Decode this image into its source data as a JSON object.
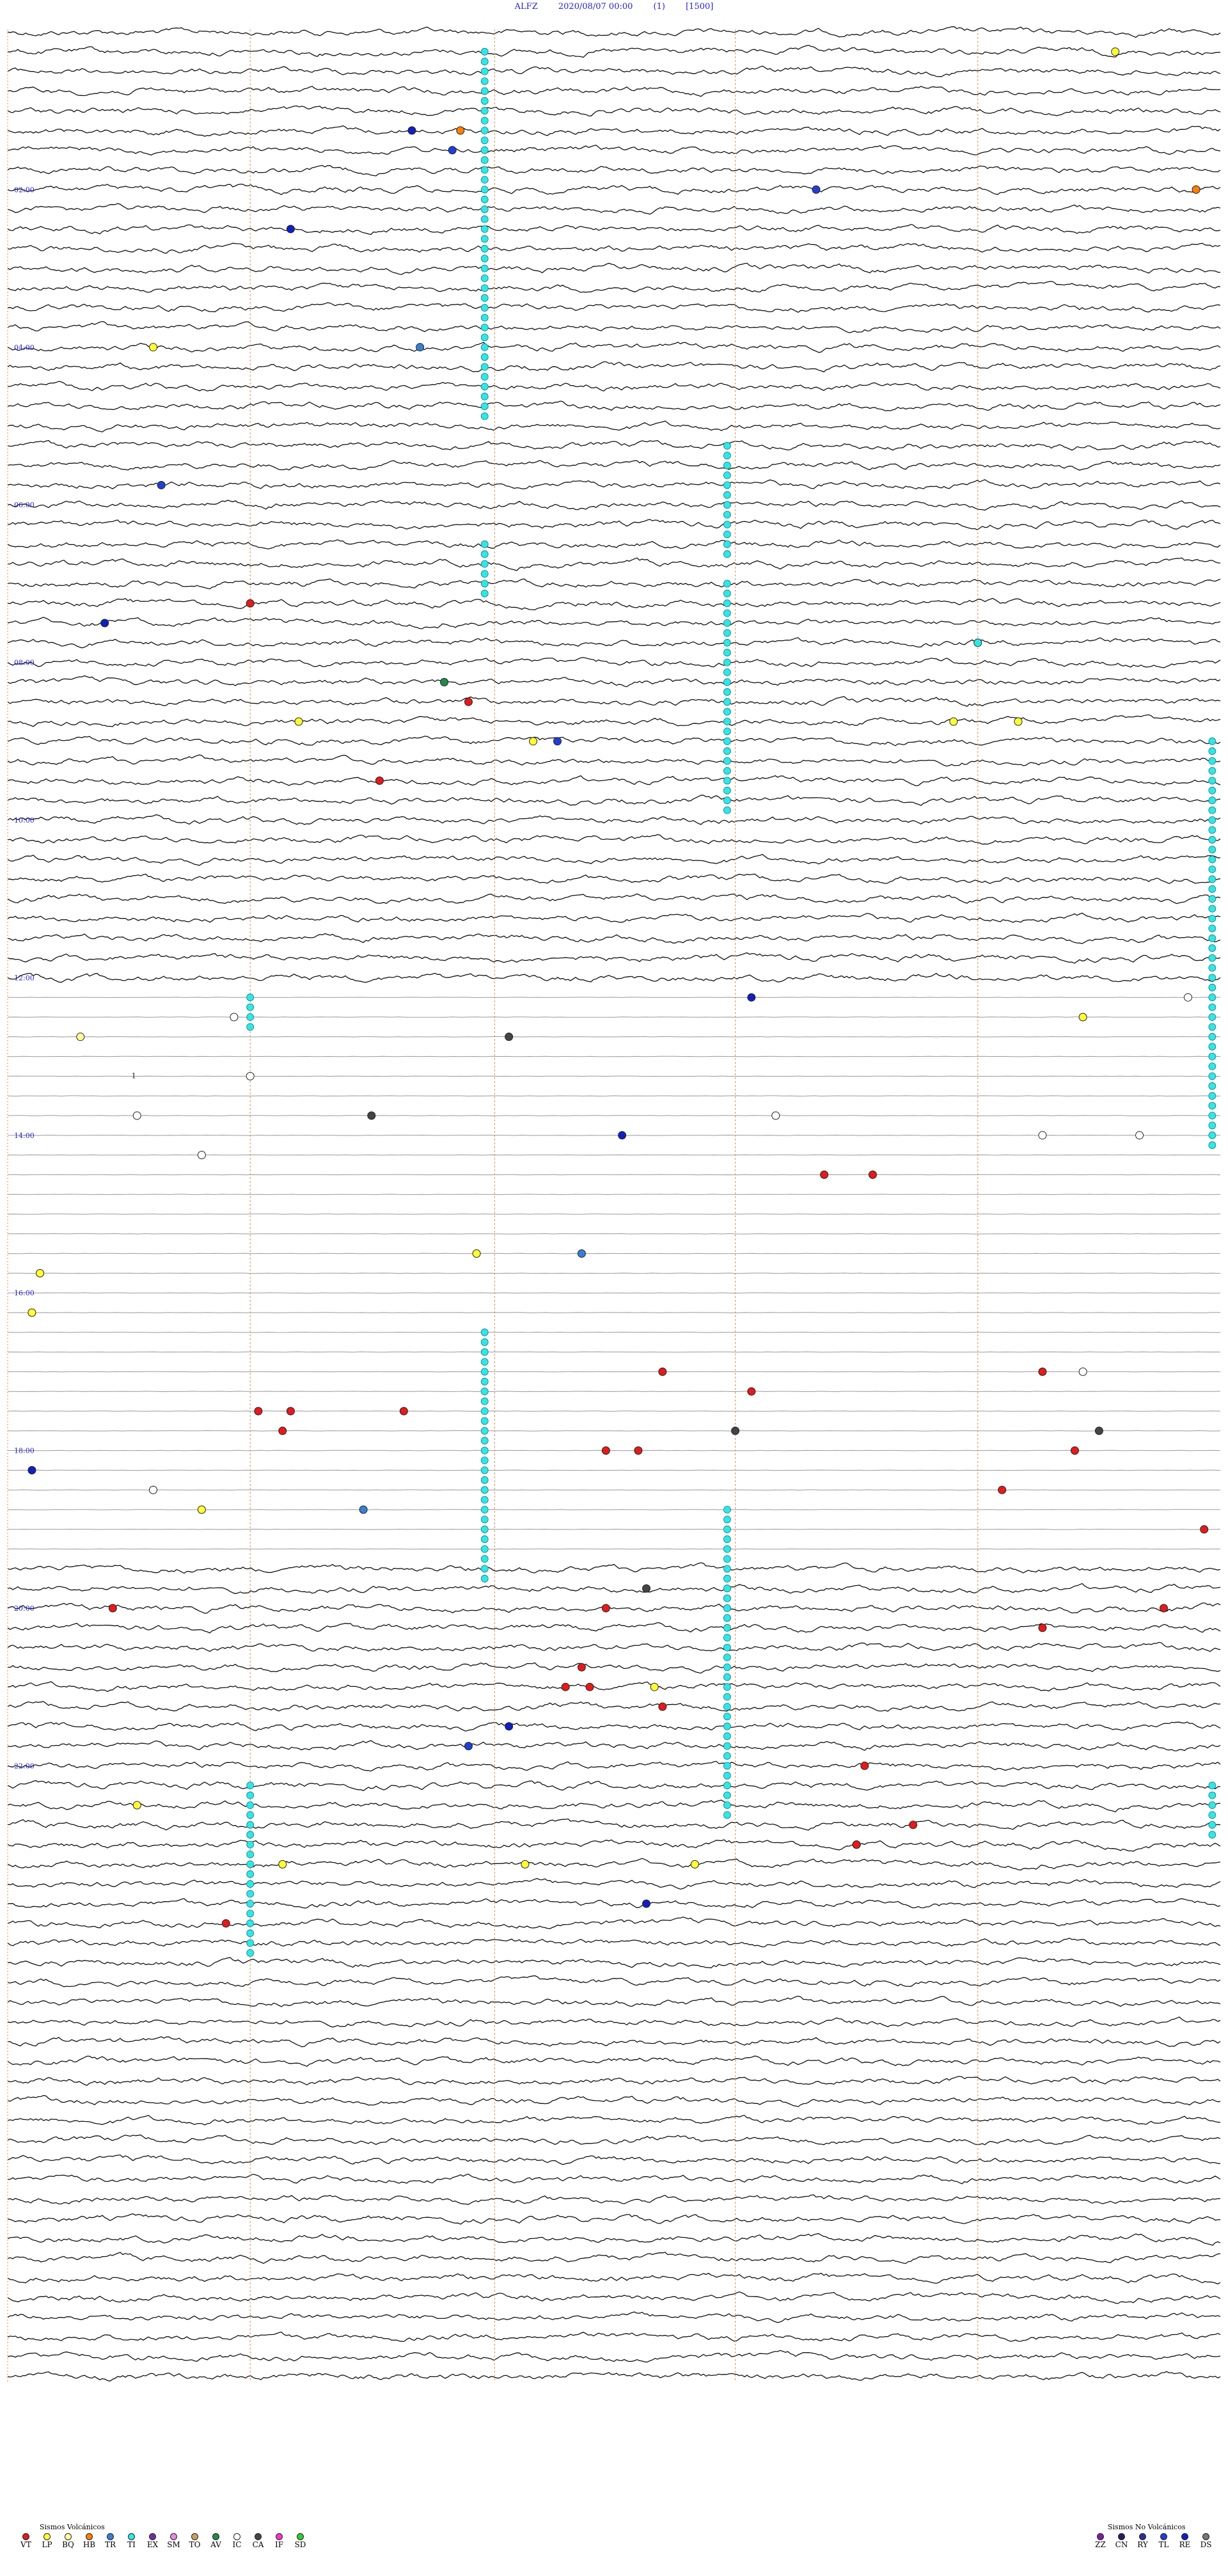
{
  "header": {
    "station": "ALFZ",
    "datetime": "2020/08/07 00:00",
    "channel": "(1)",
    "scale": "[1500]"
  },
  "chart_data": {
    "type": "helicorder",
    "rows": 120,
    "row_minutes": 15,
    "time_labels": [
      {
        "row": 8,
        "text": "02:00"
      },
      {
        "row": 16,
        "text": "04:00"
      },
      {
        "row": 24,
        "text": "06:00"
      },
      {
        "row": 32,
        "text": "08:00"
      },
      {
        "row": 40,
        "text": "10:00"
      },
      {
        "row": 48,
        "text": "12:00"
      },
      {
        "row": 56,
        "text": "14:00"
      },
      {
        "row": 64,
        "text": "16:00"
      },
      {
        "row": 72,
        "text": "18:00"
      },
      {
        "row": 80,
        "text": "20:00"
      },
      {
        "row": 88,
        "text": "22:00"
      }
    ],
    "flat_rows": [
      49,
      78
    ],
    "annotation": {
      "row": 53,
      "minute": 1.5,
      "text": "1"
    },
    "events": [
      {
        "row": 1,
        "minute": 13.7,
        "type": "LP"
      },
      {
        "row": 5,
        "minute": 5.0,
        "type": "RE"
      },
      {
        "row": 5,
        "minute": 5.6,
        "type": "HB"
      },
      {
        "row": 6,
        "minute": 5.5,
        "type": "TL"
      },
      {
        "row": 8,
        "minute": 10.0,
        "type": "TL"
      },
      {
        "row": 8,
        "minute": 14.7,
        "type": "HB"
      },
      {
        "row": 10,
        "minute": 3.5,
        "type": "RE"
      },
      {
        "row": 16,
        "minute": 1.8,
        "type": "LP"
      },
      {
        "row": 16,
        "minute": 5.1,
        "type": "TR"
      },
      {
        "row": 23,
        "minute": 1.9,
        "type": "TL"
      },
      {
        "row": 29,
        "minute": 3.0,
        "type": "VT"
      },
      {
        "row": 30,
        "minute": 1.2,
        "type": "RE"
      },
      {
        "row": 31,
        "minute": 12.0,
        "type": "TI"
      },
      {
        "row": 33,
        "minute": 5.4,
        "type": "AV"
      },
      {
        "row": 34,
        "minute": 5.7,
        "type": "VT"
      },
      {
        "row": 35,
        "minute": 11.7,
        "type": "LP"
      },
      {
        "row": 35,
        "minute": 12.5,
        "type": "LP"
      },
      {
        "row": 35,
        "minute": 3.6,
        "type": "LP"
      },
      {
        "row": 36,
        "minute": 6.5,
        "type": "LP"
      },
      {
        "row": 36,
        "minute": 6.8,
        "type": "TL"
      },
      {
        "row": 38,
        "minute": 4.6,
        "type": "VT"
      },
      {
        "row": 49,
        "minute": 9.2,
        "type": "RE"
      },
      {
        "row": 49,
        "minute": 14.6,
        "type": "IC"
      },
      {
        "row": 50,
        "minute": 2.8,
        "type": "IC"
      },
      {
        "row": 50,
        "minute": 13.3,
        "type": "LP"
      },
      {
        "row": 51,
        "minute": 0.9,
        "type": "BQ"
      },
      {
        "row": 51,
        "minute": 6.2,
        "type": "CA"
      },
      {
        "row": 53,
        "minute": 3.0,
        "type": "IC"
      },
      {
        "row": 55,
        "minute": 1.6,
        "type": "IC"
      },
      {
        "row": 55,
        "minute": 4.5,
        "type": "CA"
      },
      {
        "row": 55,
        "minute": 9.5,
        "type": "IC"
      },
      {
        "row": 56,
        "minute": 7.6,
        "type": "RE"
      },
      {
        "row": 56,
        "minute": 12.8,
        "type": "IC"
      },
      {
        "row": 56,
        "minute": 14.0,
        "type": "IC"
      },
      {
        "row": 57,
        "minute": 2.4,
        "type": "IC"
      },
      {
        "row": 58,
        "minute": 10.1,
        "type": "VT"
      },
      {
        "row": 58,
        "minute": 10.7,
        "type": "VT"
      },
      {
        "row": 62,
        "minute": 5.8,
        "type": "LP"
      },
      {
        "row": 62,
        "minute": 7.1,
        "type": "TR"
      },
      {
        "row": 63,
        "minute": 0.4,
        "type": "LP"
      },
      {
        "row": 65,
        "minute": 0.3,
        "type": "LP"
      },
      {
        "row": 68,
        "minute": 8.1,
        "type": "VT"
      },
      {
        "row": 68,
        "minute": 12.8,
        "type": "VT"
      },
      {
        "row": 68,
        "minute": 13.3,
        "type": "IC"
      },
      {
        "row": 69,
        "minute": 9.2,
        "type": "VT"
      },
      {
        "row": 70,
        "minute": 3.1,
        "type": "VT"
      },
      {
        "row": 70,
        "minute": 3.5,
        "type": "VT"
      },
      {
        "row": 70,
        "minute": 4.9,
        "type": "VT"
      },
      {
        "row": 71,
        "minute": 9.0,
        "type": "CA"
      },
      {
        "row": 71,
        "minute": 13.5,
        "type": "CA"
      },
      {
        "row": 71,
        "minute": 3.4,
        "type": "VT"
      },
      {
        "row": 72,
        "minute": 7.4,
        "type": "VT"
      },
      {
        "row": 72,
        "minute": 7.8,
        "type": "VT"
      },
      {
        "row": 72,
        "minute": 13.2,
        "type": "VT"
      },
      {
        "row": 73,
        "minute": 0.3,
        "type": "RE"
      },
      {
        "row": 74,
        "minute": 1.8,
        "type": "VT"
      },
      {
        "row": 74,
        "minute": 1.8,
        "type": "IC"
      },
      {
        "row": 74,
        "minute": 12.3,
        "type": "VT"
      },
      {
        "row": 75,
        "minute": 2.4,
        "type": "LP"
      },
      {
        "row": 75,
        "minute": 4.4,
        "type": "TR"
      },
      {
        "row": 76,
        "minute": 14.8,
        "type": "VT"
      },
      {
        "row": 79,
        "minute": 7.9,
        "type": "CA"
      },
      {
        "row": 80,
        "minute": 1.3,
        "type": "VT"
      },
      {
        "row": 80,
        "minute": 7.4,
        "type": "VT"
      },
      {
        "row": 80,
        "minute": 14.3,
        "type": "VT"
      },
      {
        "row": 81,
        "minute": 12.8,
        "type": "VT"
      },
      {
        "row": 83,
        "minute": 7.1,
        "type": "VT"
      },
      {
        "row": 84,
        "minute": 6.9,
        "type": "VT"
      },
      {
        "row": 84,
        "minute": 7.2,
        "type": "VT"
      },
      {
        "row": 84,
        "minute": 8.0,
        "type": "LP"
      },
      {
        "row": 85,
        "minute": 8.1,
        "type": "VT"
      },
      {
        "row": 86,
        "minute": 6.2,
        "type": "RE"
      },
      {
        "row": 87,
        "minute": 5.7,
        "type": "TL"
      },
      {
        "row": 88,
        "minute": 10.6,
        "type": "VT"
      },
      {
        "row": 90,
        "minute": 1.6,
        "type": "LP"
      },
      {
        "row": 91,
        "minute": 11.2,
        "type": "VT"
      },
      {
        "row": 92,
        "minute": 10.5,
        "type": "VT"
      },
      {
        "row": 92,
        "minute": 10.5,
        "type": "VT"
      },
      {
        "row": 93,
        "minute": 6.4,
        "type": "LP"
      },
      {
        "row": 93,
        "minute": 8.5,
        "type": "LP"
      },
      {
        "row": 93,
        "minute": 3.4,
        "type": "LP"
      },
      {
        "row": 95,
        "minute": 7.9,
        "type": "RE"
      },
      {
        "row": 96,
        "minute": 2.7,
        "type": "VT"
      }
    ],
    "ti_runs": [
      {
        "start": 1,
        "end": 19,
        "minute": 5.9
      },
      {
        "start": 21,
        "end": 26,
        "minute": 8.9
      },
      {
        "start": 26,
        "end": 28,
        "minute": 5.9
      },
      {
        "start": 28,
        "end": 39,
        "minute": 8.9
      },
      {
        "start": 36,
        "end": 56,
        "minute": 14.9
      },
      {
        "start": 49,
        "end": 50,
        "minute": 3.0
      },
      {
        "start": 66,
        "end": 78,
        "minute": 5.9
      },
      {
        "start": 75,
        "end": 80,
        "minute": 8.9
      },
      {
        "start": 79,
        "end": 90,
        "minute": 8.9
      },
      {
        "start": 89,
        "end": 97,
        "minute": 3.0
      },
      {
        "start": 89,
        "end": 91,
        "minute": 14.9
      }
    ],
    "legend_volcanic": {
      "title": "Sismos Volcánicos",
      "items": [
        {
          "code": "VT",
          "color": "#e41a1c"
        },
        {
          "code": "LP",
          "color": "#ffff33"
        },
        {
          "code": "BQ",
          "color": "#ffff99"
        },
        {
          "code": "HB",
          "color": "#ff7f00"
        },
        {
          "code": "TR",
          "color": "#3a7fd5"
        },
        {
          "code": "TI",
          "color": "#2ee8e8"
        },
        {
          "code": "EX",
          "color": "#7030a0"
        },
        {
          "code": "SM",
          "color": "#e08ae0"
        },
        {
          "code": "TO",
          "color": "#c8a060"
        },
        {
          "code": "AV",
          "color": "#1f8a4c"
        },
        {
          "code": "IC",
          "color": "#ffffff"
        },
        {
          "code": "CA",
          "color": "#444444"
        },
        {
          "code": "IF",
          "color": "#ff33cc"
        },
        {
          "code": "SD",
          "color": "#33cc33"
        }
      ]
    },
    "legend_nonvolcanic": {
      "title": "Sismos No Volcánicos",
      "items": [
        {
          "code": "ZZ",
          "color": "#7a1fa2"
        },
        {
          "code": "CN",
          "color": "#202060"
        },
        {
          "code": "RY",
          "color": "#303090"
        },
        {
          "code": "TL",
          "color": "#1f3fd6"
        },
        {
          "code": "RE",
          "color": "#1020c0"
        },
        {
          "code": "DS",
          "color": "#777777"
        }
      ]
    }
  }
}
